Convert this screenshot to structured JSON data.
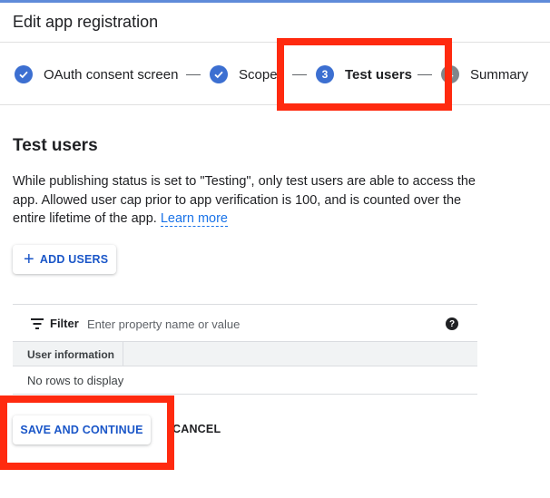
{
  "header": {
    "title": "Edit app registration"
  },
  "stepper": {
    "steps": [
      {
        "label": "OAuth consent screen",
        "state": "done",
        "icon": "check-icon"
      },
      {
        "label": "Scopes",
        "state": "done",
        "icon": "check-icon"
      },
      {
        "label": "Test users",
        "state": "active",
        "number": "3"
      },
      {
        "label": "Summary",
        "state": "pending",
        "number": "4"
      }
    ]
  },
  "section": {
    "title": "Test users",
    "description": "While publishing status is set to \"Testing\", only test users are able to access the app. Allowed user cap prior to app verification is 100, and is counted over the entire lifetime of the app.",
    "learn_more": "Learn more"
  },
  "add_users": {
    "icon": "plus-icon",
    "label": "ADD USERS"
  },
  "table": {
    "filter_label": "Filter",
    "filter_placeholder": "Enter property name or value",
    "help_icon": "help-icon",
    "columns": [
      "User information"
    ],
    "empty_text": "No rows to display"
  },
  "actions": {
    "save_label": "SAVE AND CONTINUE",
    "cancel_label": "CANCEL"
  },
  "colors": {
    "accent": "#1a56c8",
    "step_active": "#3c6fd1",
    "highlight": "#ff2a0f"
  }
}
